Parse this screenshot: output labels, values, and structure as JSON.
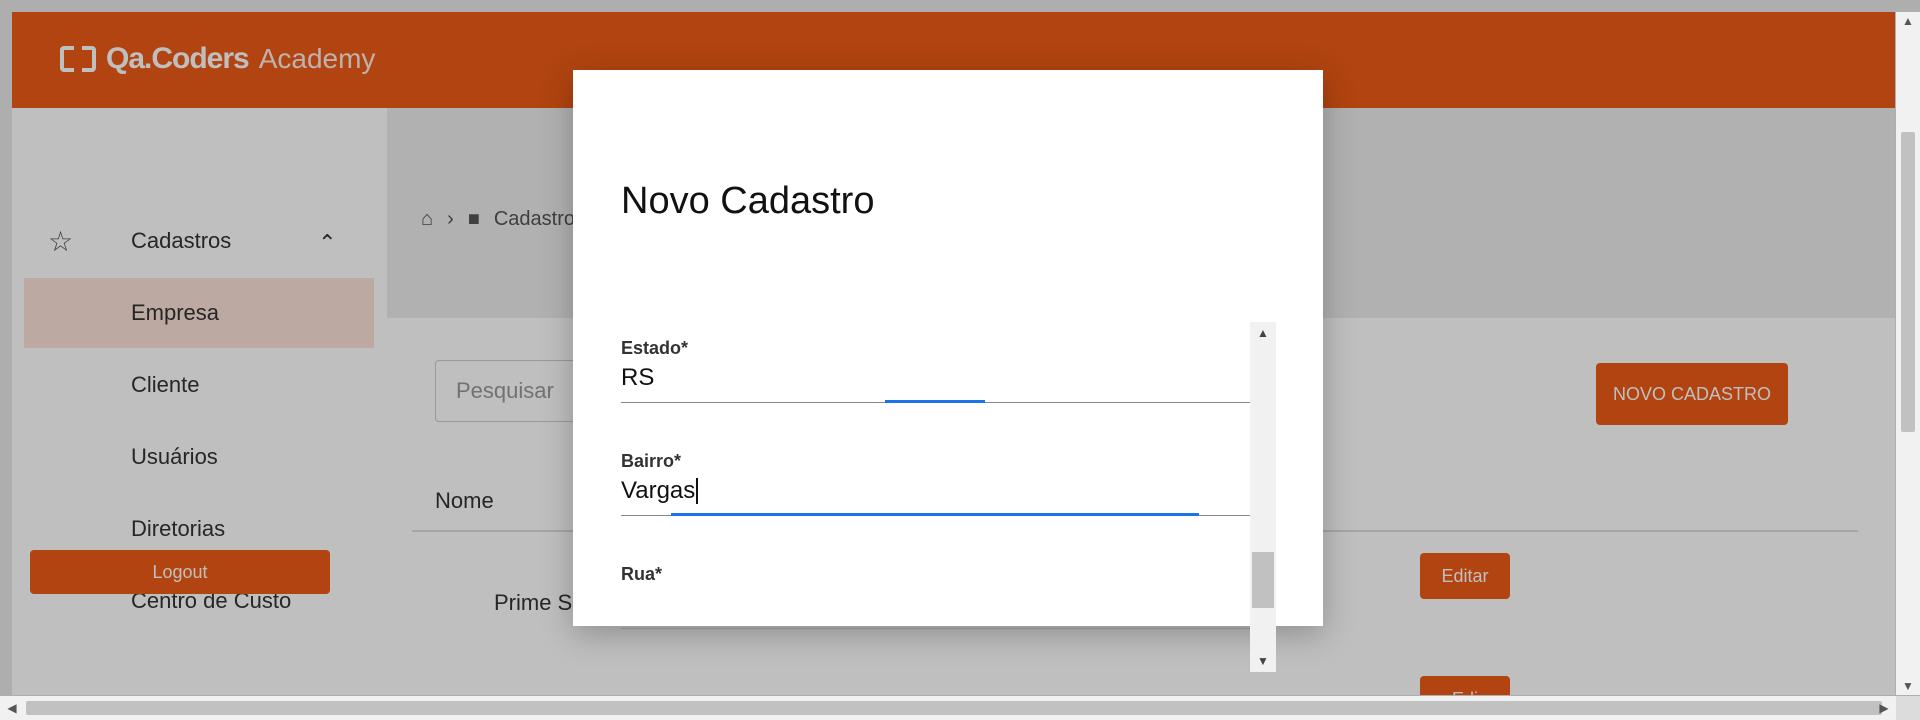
{
  "header": {
    "logo_main": "Qa.Coders",
    "logo_sub": "Academy"
  },
  "sidebar": {
    "section_label": "Cadastros",
    "items": [
      {
        "label": "Empresa",
        "active": true
      },
      {
        "label": "Cliente",
        "active": false
      },
      {
        "label": "Usuários",
        "active": false
      },
      {
        "label": "Diretorias",
        "active": false
      },
      {
        "label": "Centro de Custo",
        "active": false
      }
    ],
    "logout_label": "Logout"
  },
  "breadcrumb": {
    "current": "Cadastros"
  },
  "main": {
    "search_placeholder": "Pesquisar",
    "new_button_label": "NOVO CADASTRO",
    "column_nome": "Nome",
    "row_nome": "Prime S",
    "edit_label": "Editar",
    "edit_label_partial": "Edi"
  },
  "modal": {
    "title": "Novo Cadastro",
    "fields": [
      {
        "label": "Estado*",
        "value": "RS"
      },
      {
        "label": "Bairro*",
        "value": "Vargas"
      },
      {
        "label": "Rua*",
        "value": ""
      }
    ]
  },
  "colors": {
    "brand": "#ed5b16",
    "focus": "#1a73e8",
    "active_nav_bg": "#fbe2d7"
  }
}
